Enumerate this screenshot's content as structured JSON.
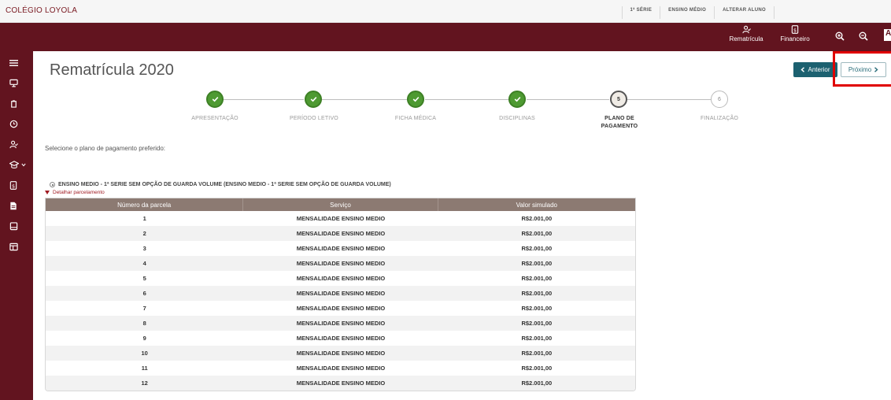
{
  "app": {
    "brand": "COLÉGIO LOYOLA"
  },
  "toplinks": [
    "1ª SÉRIE",
    "ENSINO MÉDIO",
    "ALTERAR ALUNO"
  ],
  "header": {
    "rematricula": "Rematrícula",
    "financeiro": "Financeiro",
    "partial_letter": "A"
  },
  "page": {
    "title": "Rematrícula 2020",
    "prev_label": "Anterior",
    "next_label": "Próximo"
  },
  "steps": [
    {
      "label": "APRESENTAÇÃO",
      "status": "done",
      "number": "1"
    },
    {
      "label": "PERÍODO LETIVO",
      "status": "done",
      "number": "2"
    },
    {
      "label": "FICHA MÉDICA",
      "status": "done",
      "number": "3"
    },
    {
      "label": "DISCIPLINAS",
      "status": "done",
      "number": "4"
    },
    {
      "label": "PLANO DE PAGAMENTO",
      "status": "current",
      "number": "5"
    },
    {
      "label": "FINALIZAÇÃO",
      "status": "future",
      "number": "6"
    }
  ],
  "instruction": "Selecione o plano de pagamento preferido:",
  "plan": {
    "label": "ENSINO MEDIO - 1ª SERIE SEM OPÇÃO DE GUARDA VOLUME (ENSINO MEDIO - 1ª SERIE SEM OPÇÃO DE GUARDA VOLUME)",
    "detail_link": "Detalhar parcelamento"
  },
  "table": {
    "headers": [
      "Número da parcela",
      "Serviço",
      "Valor simulado"
    ],
    "rows": [
      [
        "1",
        "MENSALIDADE ENSINO MEDIO",
        "R$2.001,00"
      ],
      [
        "2",
        "MENSALIDADE ENSINO MEDIO",
        "R$2.001,00"
      ],
      [
        "3",
        "MENSALIDADE ENSINO MEDIO",
        "R$2.001,00"
      ],
      [
        "4",
        "MENSALIDADE ENSINO MEDIO",
        "R$2.001,00"
      ],
      [
        "5",
        "MENSALIDADE ENSINO MEDIO",
        "R$2.001,00"
      ],
      [
        "6",
        "MENSALIDADE ENSINO MEDIO",
        "R$2.001,00"
      ],
      [
        "7",
        "MENSALIDADE ENSINO MEDIO",
        "R$2.001,00"
      ],
      [
        "8",
        "MENSALIDADE ENSINO MEDIO",
        "R$2.001,00"
      ],
      [
        "9",
        "MENSALIDADE ENSINO MEDIO",
        "R$2.001,00"
      ],
      [
        "10",
        "MENSALIDADE ENSINO MEDIO",
        "R$2.001,00"
      ],
      [
        "11",
        "MENSALIDADE ENSINO MEDIO",
        "R$2.001,00"
      ],
      [
        "12",
        "MENSALIDADE ENSINO MEDIO",
        "R$2.001,00"
      ]
    ]
  },
  "sidebar": {
    "items": [
      "menu-icon",
      "monitor-icon",
      "clipboard-icon",
      "clock-icon",
      "user-check-icon",
      "school-icon",
      "invoice-icon",
      "document-icon",
      "laptop-icon",
      "layout-icon"
    ]
  },
  "colors": {
    "primary": "#62141f",
    "done": "#4e9a32",
    "teal": "#1c6170",
    "table_header": "#8c7a72",
    "highlight": "#e00000"
  }
}
